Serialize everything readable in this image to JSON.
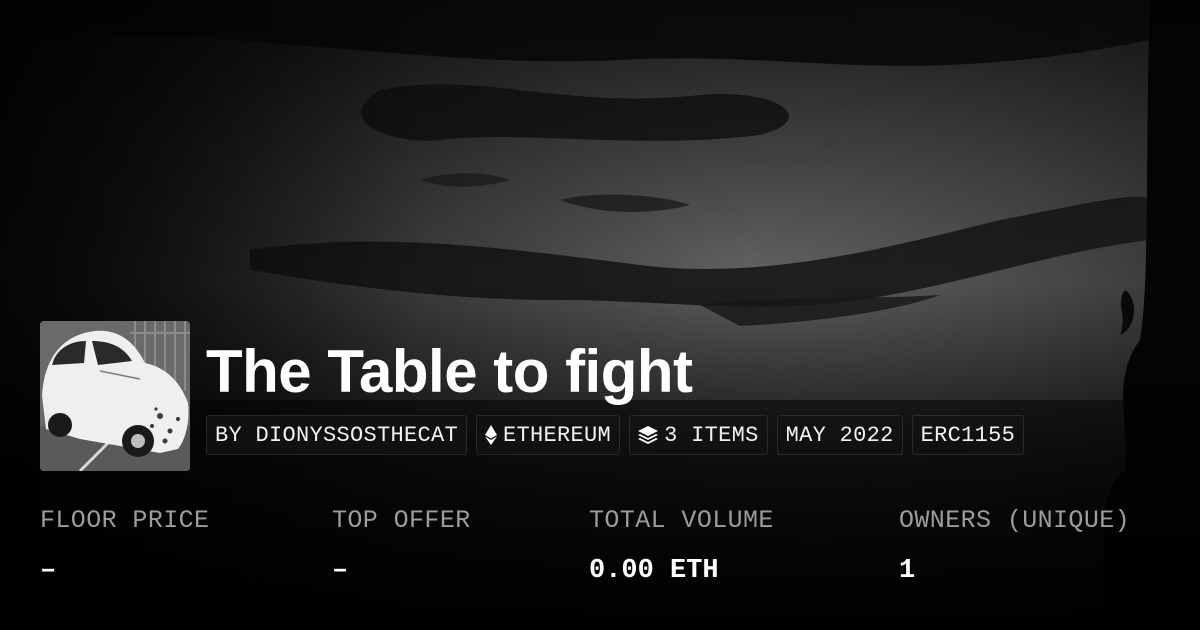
{
  "collection": {
    "name": "The Table to fight",
    "chips": [
      {
        "label": "BY DIONYSSOSTHECAT",
        "icon": ""
      },
      {
        "label": "ETHEREUM",
        "icon": "ethereum-icon"
      },
      {
        "label": "3 ITEMS",
        "icon": "layers-icon"
      },
      {
        "label": "MAY 2022",
        "icon": ""
      },
      {
        "label": "ERC1155",
        "icon": ""
      }
    ]
  },
  "stats": [
    {
      "label": "FLOOR PRICE",
      "value": "–"
    },
    {
      "label": "TOP OFFER",
      "value": "–"
    },
    {
      "label": "TOTAL VOLUME",
      "value": "0.00 ETH"
    },
    {
      "label": "OWNERS (UNIQUE)",
      "value": "1"
    }
  ],
  "colors": {
    "background": "#000000",
    "text": "#ffffff",
    "muted_label": "#9c9c9c",
    "chip_bg": "#121212"
  }
}
